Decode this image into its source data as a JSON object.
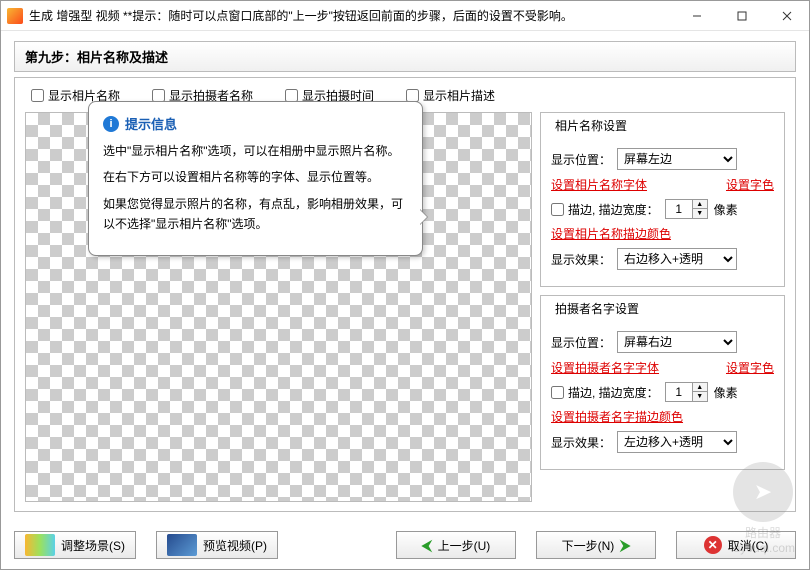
{
  "titlebar": {
    "text": "生成 增强型 视频  **提示：随时可以点窗口底部的\"上一步\"按钮返回前面的步骤，后面的设置不受影响。"
  },
  "step_header": "第九步：相片名称及描述",
  "checkboxes": {
    "c1": "显示相片名称",
    "c2": "显示拍摄者名称",
    "c3": "显示拍摄时间",
    "c4": "显示相片描述"
  },
  "tooltip": {
    "title": "提示信息",
    "p1": "选中\"显示相片名称\"选项，可以在相册中显示照片名称。",
    "p2": "在右下方可以设置相片名称等的字体、显示位置等。",
    "p3": "如果您觉得显示照片的名称，有点乱，影响相册效果，可以不选择\"显示相片名称\"选项。"
  },
  "group1": {
    "title": "相片名称设置",
    "pos_label": "显示位置：",
    "pos_value": "屏幕左边",
    "font_link": "设置相片名称字体",
    "color_link": "设置字色",
    "outline_cb": "描边, 描边宽度：",
    "outline_val": "1",
    "outline_unit": "像素",
    "outline_color_link": "设置相片名称描边颜色",
    "effect_label": "显示效果：",
    "effect_value": "右边移入+透明"
  },
  "group2": {
    "title": "拍摄者名字设置",
    "pos_label": "显示位置：",
    "pos_value": "屏幕右边",
    "font_link": "设置拍摄者名字字体",
    "color_link": "设置字色",
    "outline_cb": "描边, 描边宽度：",
    "outline_val": "1",
    "outline_unit": "像素",
    "outline_color_link": "设置拍摄者名字描边颜色",
    "effect_label": "显示效果：",
    "effect_value": "左边移入+透明"
  },
  "footer": {
    "adjust": "调整场景(S)",
    "preview": "预览视频(P)",
    "prev": "上一步(U)",
    "next": "下一步(N)",
    "cancel": "取消(C)"
  },
  "watermark": "路由器\nluyouqi.com"
}
